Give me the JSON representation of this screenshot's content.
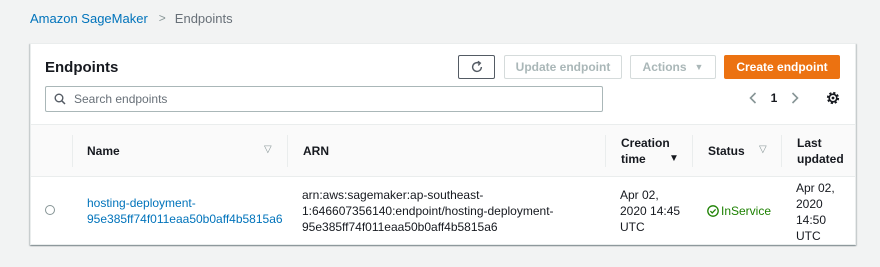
{
  "breadcrumb": {
    "root": "Amazon SageMaker",
    "separator": ">",
    "current": "Endpoints"
  },
  "panel": {
    "title": "Endpoints",
    "buttons": {
      "update": "Update endpoint",
      "actions": "Actions",
      "create": "Create endpoint"
    },
    "search_placeholder": "Search endpoints",
    "pagination": {
      "current_page": "1"
    }
  },
  "table": {
    "headers": {
      "name": "Name",
      "arn": "ARN",
      "creation_time": "Creation\ntime",
      "status": "Status",
      "last_updated": "Last\nupdated"
    },
    "rows": [
      {
        "name": "hosting-deployment-\n95e385ff74f011eaa50b0aff4b5815a6",
        "arn": "arn:aws:sagemaker:ap-southeast-\n1:646607356140:endpoint/hosting-deployment-\n95e385ff74f011eaa50b0aff4b5815a6",
        "creation_time": "Apr 02,\n2020 14:45\nUTC",
        "status": "InService",
        "last_updated": "Apr 02,\n2020\n14:50\nUTC"
      }
    ]
  },
  "colors": {
    "link": "#0073bb",
    "primary_button": "#ec7211",
    "status_ok": "#1d8102"
  }
}
